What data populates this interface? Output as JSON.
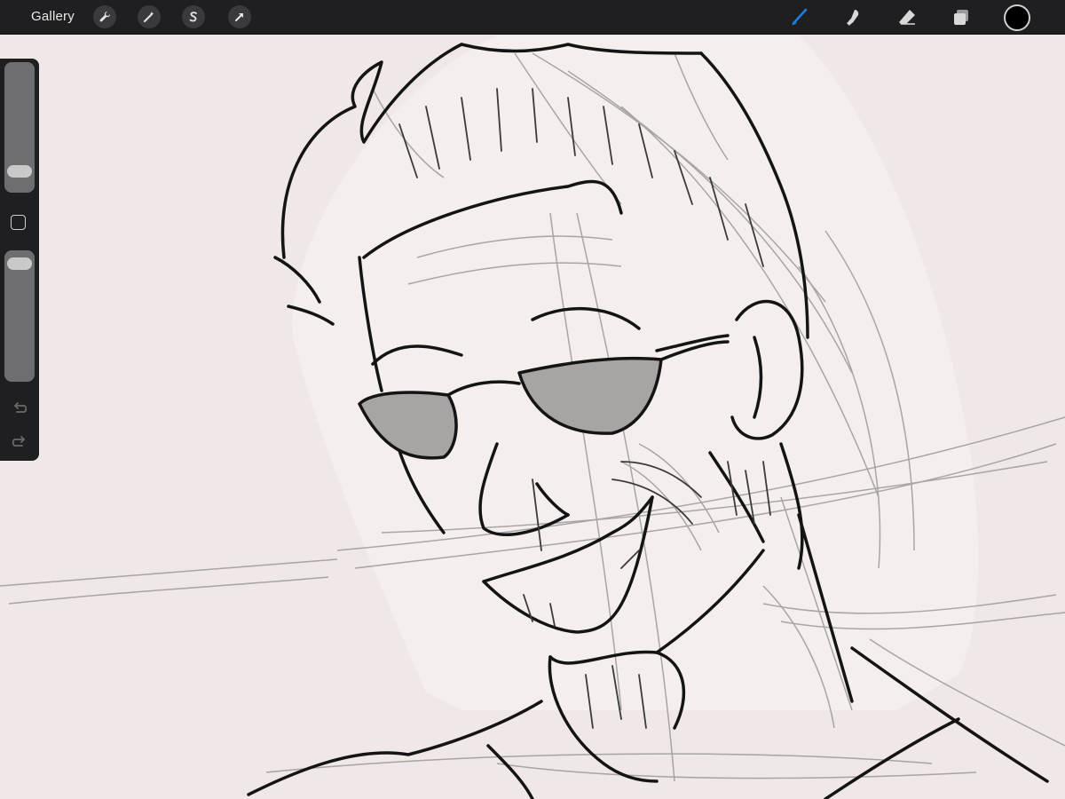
{
  "topbar": {
    "gallery_label": "Gallery",
    "left_tools": [
      {
        "name": "actions",
        "icon": "wrench-icon"
      },
      {
        "name": "adjustments",
        "icon": "magic-wand-icon"
      },
      {
        "name": "selection",
        "icon": "selection-s-icon"
      },
      {
        "name": "transform",
        "icon": "arrow-cursor-icon"
      }
    ],
    "right_tools": [
      {
        "name": "brush",
        "icon": "brush-icon",
        "active": true
      },
      {
        "name": "smudge",
        "icon": "smudge-icon",
        "active": false
      },
      {
        "name": "eraser",
        "icon": "eraser-icon",
        "active": false
      },
      {
        "name": "layers",
        "icon": "layers-icon",
        "active": false
      }
    ],
    "current_color": "#000000"
  },
  "sidebar": {
    "brush_size_level": 0.18,
    "brush_opacity_level": 0.9,
    "icons": [
      "modify-square-icon",
      "undo-arrow-icon",
      "redo-arrow-icon"
    ]
  },
  "colors": {
    "toolbar_bg": "#1f1f21",
    "canvas_bg": "#efe8e6",
    "accent_active": "#1a7de0",
    "ink": "#141414",
    "lens_gray": "#a8a4a4"
  }
}
